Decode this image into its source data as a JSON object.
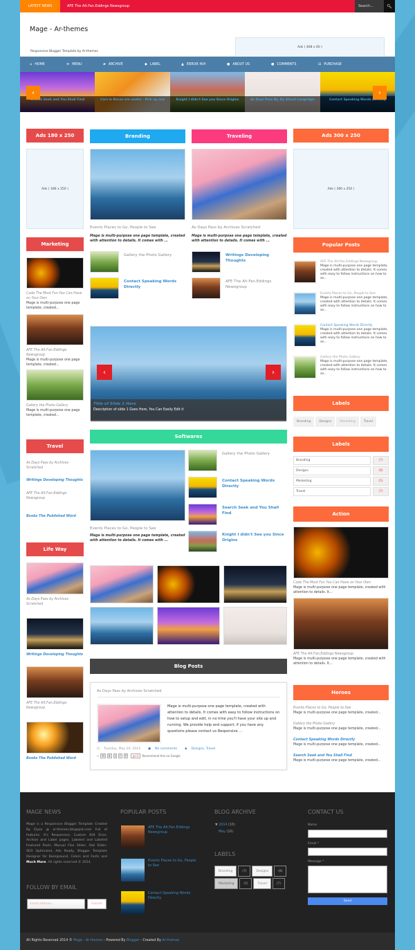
{
  "topbar": {
    "latest_label": "LATEST NEWS",
    "ticker_text": "AFE The Alt.Fan.Eddings Newsgroup",
    "search_placeholder": "Search...",
    "search_icon": "search-icon"
  },
  "header": {
    "site_title": "Mage - Ar-themes",
    "tagline": "Responsive Blogger Template by Ar-themes",
    "ad_468": "Ads ( 468 x 60 )"
  },
  "nav": {
    "items": [
      {
        "label": "HOME",
        "icon": "home-icon"
      },
      {
        "label": "MENU",
        "icon": "menu-icon"
      },
      {
        "label": "ARCHIVE",
        "icon": "folder-icon"
      },
      {
        "label": "LABEL",
        "icon": "tag-icon"
      },
      {
        "label": "ERROR 404",
        "icon": "warning-icon"
      },
      {
        "label": "ABOUT US",
        "icon": "info-icon"
      },
      {
        "label": "COMMENTS",
        "icon": "comments-icon"
      },
      {
        "label": "PURCHASE",
        "icon": "cart-icon"
      }
    ]
  },
  "carousel": {
    "slides": [
      "Search Seek and You Shall Find",
      "Cars in Races are useful - Pick up one",
      "Knight I didn't See you Since Origins",
      "As Days Pass By, By Stuart Langridge",
      "Contact Speaking Words Directly"
    ],
    "prev": "‹",
    "next": "›"
  },
  "left": {
    "ads_header": "Ads 180 x 250",
    "ads_box": "Ads ( 180 x 250 )",
    "marketing": {
      "header": "Marketing",
      "items": [
        {
          "title": "Code The Most Fun You Can Have on Your Own",
          "desc": "Mage is multi-purpose one page template, created..."
        },
        {
          "title": "AFE The Alt.Fan.Eddings Newsgroup",
          "desc": "Mage is multi-purpose one page template, created..."
        },
        {
          "title": "Gallery the Photo Gallery",
          "desc": "Mage is multi-purpose one page template, created..."
        }
      ]
    },
    "travel": {
      "header": "Travel",
      "items": [
        {
          "title": "As Days Pass by Archives Scratched",
          "highlight": false
        },
        {
          "title": "Writings Developing Thoughts",
          "highlight": true
        },
        {
          "title": "AFE The Alt.Fan.Eddings Newsgroup",
          "highlight": false
        },
        {
          "title": "Books The Published Word",
          "highlight": true
        }
      ]
    },
    "lifeway": {
      "header": "Life Way",
      "items": [
        "As Days Pass by Archives Scratched",
        "Writings Developing Thoughts",
        "AFE The Alt.Fan.Eddings Newsgroup",
        "Books The Published Word"
      ]
    }
  },
  "center": {
    "branding": {
      "header": "Branding",
      "main_title": "Events Places to Go, People to See",
      "main_desc": "Mage is multi-purpose one page template, created with attention to details. It comes with ...",
      "list": [
        "Gallery the Photo Gallery",
        "Contact Speaking Words Directly"
      ]
    },
    "traveling": {
      "header": "Traveling",
      "main_title": "As Days Pass by Archives Scratched",
      "main_desc": "Mage is multi-purpose one page template, created with attention to details. It comes with ...",
      "list": [
        "Writings Developing Thoughts",
        "AFE The Alt.Fan.Eddings Newsgroup"
      ]
    },
    "slider": {
      "title": "Title of Slide 1 Here",
      "desc": "Description of slide 1 Goes Here, You Can Easily Edit it"
    },
    "softwares": {
      "header": "Softwares",
      "main_title": "Events Places to Go, People to See",
      "main_desc": "Mage is multi-purpose one page template, created with attention to details. It comes with ...",
      "list": [
        "Gallery the Photo Gallery",
        "Contact Speaking Words Directly",
        "Search Seek and You Shall Find",
        "Knight I didn't See you Since Origins"
      ]
    },
    "blog": {
      "header": "Blog Posts",
      "post_title": "As Days Pass by Archives Scratched",
      "post_body": "Mage is multi-purpose one page template, created with attention to details. It comes with easy to follow instructions on how to setup and edit, in no time you'll have your site up and running. We provide help and support, if you have any questions please contact us Responsive ...",
      "date": "Tuesday, May 20, 2014",
      "comments": "No comments",
      "labels": "Designs, Travel",
      "share_note": "Recommend this on Google",
      "gplus": "g+1"
    }
  },
  "right": {
    "ads_header": "Ads 300 x 250",
    "ads_box": "Ads ( 300 x 250 )",
    "popular": {
      "header": "Popular Posts",
      "items": [
        {
          "title": "AFE The Alt.Fan.Eddings Newsgroup",
          "desc": "Mage is multi-purpose one page template, created with attention to details. It comes with easy to follow instructions on how to se..."
        },
        {
          "title": "Events Places to Go, People to See",
          "desc": "Mage is multi-purpose one page template, created with attention to details. It comes with easy to follow instructions on how to se..."
        },
        {
          "title": "Contact Speaking Words Directly",
          "desc": "Mage is multi-purpose one page template, created with attention to details. It comes with easy to follow instructions on how to se..."
        },
        {
          "title": "Gallery the Photo Gallery",
          "desc": "Mage is multi-purpose one page template, created with attention to details. It comes with easy to follow instructions on how to se..."
        }
      ]
    },
    "labels_cloud": {
      "header": "Labels",
      "items": [
        "Branding",
        "Designs",
        "Marketing",
        "Travel"
      ]
    },
    "labels_list": {
      "header": "Labels",
      "items": [
        {
          "name": "Branding",
          "count": "(7)"
        },
        {
          "name": "Designs",
          "count": "(8)"
        },
        {
          "name": "Marketing",
          "count": "(5)"
        },
        {
          "name": "Travel",
          "count": "(7)"
        }
      ]
    },
    "action": {
      "header": "Action",
      "items": [
        {
          "title": "Code The Most Fun You Can Have on Your Own",
          "desc": "Mage is multi-purpose one page template, created with attention to details. It..."
        },
        {
          "title": "AFE The Alt.Fan.Eddings Newsgroup",
          "desc": "Mage is multi-purpose one page template, created with attention to details. It..."
        }
      ]
    },
    "heroes": {
      "header": "Heroes",
      "items": [
        {
          "title": "Events Places to Go, People to See",
          "desc": "Mage is multi-purpose one page template, created...",
          "highlight": false
        },
        {
          "title": "Gallery the Photo Gallery",
          "desc": "Mage is multi-purpose one page template, created...",
          "highlight": false
        },
        {
          "title": "Contact Speaking Words Directly",
          "desc": "Mage is multi-purpose one page template, created...",
          "highlight": true
        },
        {
          "title": "Search Seek and You Shall Find",
          "desc": "Mage is multi-purpose one page template, created...",
          "highlight": true
        }
      ]
    }
  },
  "footer": {
    "news_header": "MAGE NEWS",
    "news_text": "Mage is a Responsive Blogger Template Created By Elyza @ ar-themes.blogspot.com Full of features. It's Responsive, Custom 404 Error, Archive and Label pages, Labeled and Labeled Featured Posts, Manual Flex Slider, Owl Slider, SEO Optimized, Ads Ready, Blogger Template Designer for Background, Colors and Fonts and",
    "news_more": "Much More",
    "news_tail": ". All rights reserved © 2014.",
    "follow_header": "FOLLOW BY EMAIL",
    "email_placeholder": "Email address...",
    "submit": "Submit",
    "popular_header": "POPULAR POSTS",
    "popular": [
      "AFE The Alt.Fan.Eddings Newsgroup",
      "Events Places to Go, People to See",
      "Contact Speaking Words Directly"
    ],
    "archive_header": "BLOG ARCHIVE",
    "archive_year": "2014",
    "archive_year_count": "(16)",
    "archive_month": "May",
    "archive_month_count": "(16)",
    "labels_header": "LABELS",
    "labels": [
      {
        "name": "Branding",
        "count": "(7)"
      },
      {
        "name": "Designs",
        "count": "(8)"
      },
      {
        "name": "Marketing",
        "count": "(5)"
      },
      {
        "name": "Travel",
        "count": "(7)"
      }
    ],
    "contact_header": "CONTACT US",
    "name_label": "Name",
    "email_label": "Email *",
    "message_label": "Message *",
    "send": "Send"
  },
  "bottom": {
    "prefix": "All Rights Reserved 2014 ©",
    "site_link": "Mage - Ar-themes",
    "powered": "- Powered By",
    "blogger": "Blogger",
    "created": "- Created By",
    "author": "Ar-themes"
  }
}
